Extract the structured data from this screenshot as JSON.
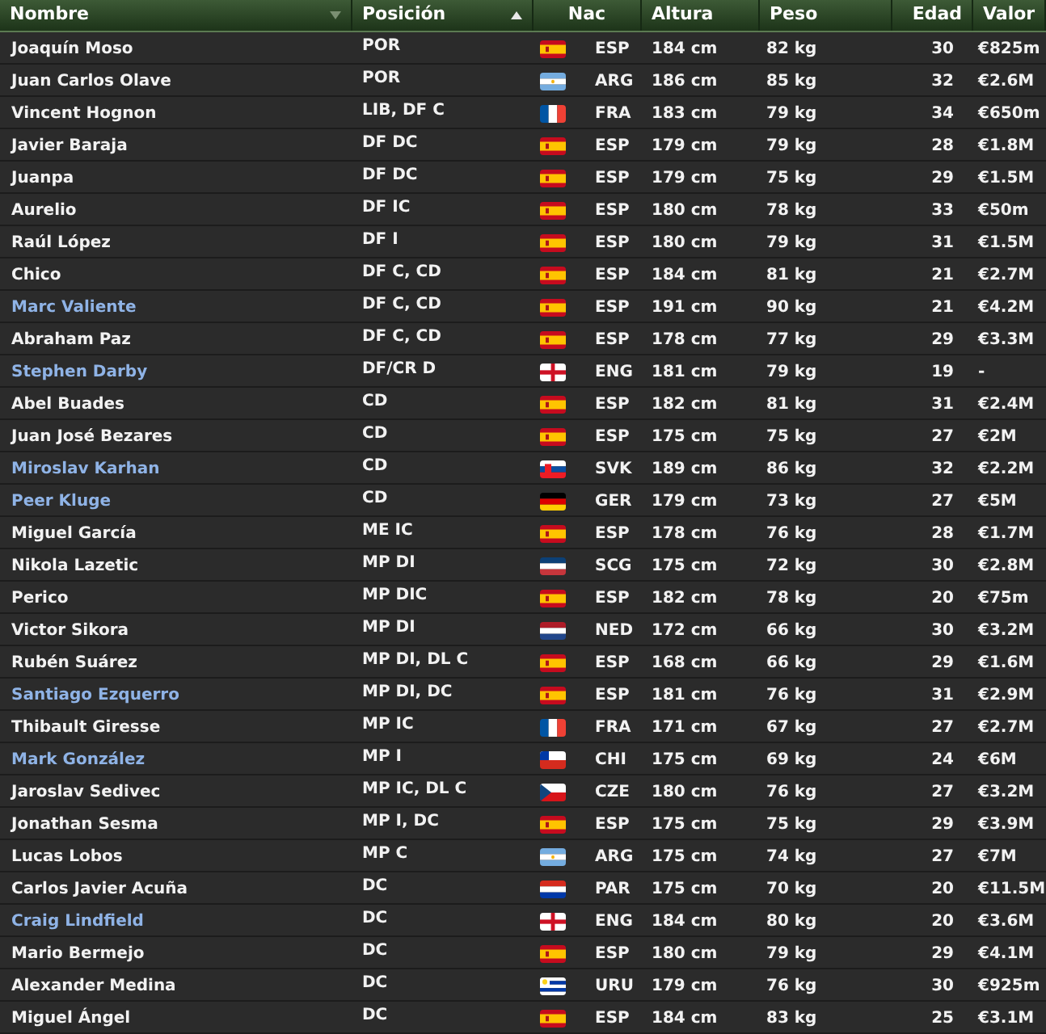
{
  "columns": [
    {
      "label": "Nombre",
      "sort": {
        "kind": "desc"
      }
    },
    {
      "label": "Posición",
      "sort": {
        "kind": "asc"
      }
    },
    {
      "label": "Nac"
    },
    {
      "label": "Altura"
    },
    {
      "label": "Peso"
    },
    {
      "label": "Edad"
    },
    {
      "label": "Valor"
    }
  ],
  "rows": [
    {
      "name": "Joaquín Moso",
      "highlighted": false,
      "position": "POR",
      "flag": {
        "kind": "es"
      },
      "nation": "ESP",
      "height": "184 cm",
      "weight": "82 kg",
      "age": "30",
      "value": "€825m"
    },
    {
      "name": "Juan Carlos Olave",
      "highlighted": false,
      "position": "POR",
      "flag": {
        "kind": "ar"
      },
      "nation": "ARG",
      "height": "186 cm",
      "weight": "85 kg",
      "age": "32",
      "value": "€2.6M"
    },
    {
      "name": "Vincent Hognon",
      "highlighted": false,
      "position": "LIB, DF C",
      "flag": {
        "kind": "fr"
      },
      "nation": "FRA",
      "height": "183 cm",
      "weight": "79 kg",
      "age": "34",
      "value": "€650m"
    },
    {
      "name": "Javier Baraja",
      "highlighted": false,
      "position": "DF DC",
      "flag": {
        "kind": "es"
      },
      "nation": "ESP",
      "height": "179 cm",
      "weight": "79 kg",
      "age": "28",
      "value": "€1.8M"
    },
    {
      "name": "Juanpa",
      "highlighted": false,
      "position": "DF DC",
      "flag": {
        "kind": "es"
      },
      "nation": "ESP",
      "height": "179 cm",
      "weight": "75 kg",
      "age": "29",
      "value": "€1.5M"
    },
    {
      "name": "Aurelio",
      "highlighted": false,
      "position": "DF IC",
      "flag": {
        "kind": "es"
      },
      "nation": "ESP",
      "height": "180 cm",
      "weight": "78 kg",
      "age": "33",
      "value": "€50m"
    },
    {
      "name": "Raúl López",
      "highlighted": false,
      "position": "DF I",
      "flag": {
        "kind": "es"
      },
      "nation": "ESP",
      "height": "180 cm",
      "weight": "79 kg",
      "age": "31",
      "value": "€1.5M"
    },
    {
      "name": "Chico",
      "highlighted": false,
      "position": "DF C, CD",
      "flag": {
        "kind": "es"
      },
      "nation": "ESP",
      "height": "184 cm",
      "weight": "81 kg",
      "age": "21",
      "value": "€2.7M"
    },
    {
      "name": "Marc Valiente",
      "highlighted": true,
      "position": "DF C, CD",
      "flag": {
        "kind": "es"
      },
      "nation": "ESP",
      "height": "191 cm",
      "weight": "90 kg",
      "age": "21",
      "value": "€4.2M"
    },
    {
      "name": "Abraham Paz",
      "highlighted": false,
      "position": "DF C, CD",
      "flag": {
        "kind": "es"
      },
      "nation": "ESP",
      "height": "178 cm",
      "weight": "77 kg",
      "age": "29",
      "value": "€3.3M"
    },
    {
      "name": "Stephen Darby",
      "highlighted": true,
      "position": "DF/CR D",
      "flag": {
        "kind": "en"
      },
      "nation": "ENG",
      "height": "181 cm",
      "weight": "79 kg",
      "age": "19",
      "value": "-"
    },
    {
      "name": "Abel Buades",
      "highlighted": false,
      "position": "CD",
      "flag": {
        "kind": "es"
      },
      "nation": "ESP",
      "height": "182 cm",
      "weight": "81 kg",
      "age": "31",
      "value": "€2.4M"
    },
    {
      "name": "Juan José Bezares",
      "highlighted": false,
      "position": "CD",
      "flag": {
        "kind": "es"
      },
      "nation": "ESP",
      "height": "175 cm",
      "weight": "75 kg",
      "age": "27",
      "value": "€2M"
    },
    {
      "name": "Miroslav Karhan",
      "highlighted": true,
      "position": "CD",
      "flag": {
        "kind": "sk"
      },
      "nation": "SVK",
      "height": "189 cm",
      "weight": "86 kg",
      "age": "32",
      "value": "€2.2M"
    },
    {
      "name": "Peer Kluge",
      "highlighted": true,
      "position": "CD",
      "flag": {
        "kind": "de"
      },
      "nation": "GER",
      "height": "179 cm",
      "weight": "73 kg",
      "age": "27",
      "value": "€5M"
    },
    {
      "name": "Miguel García",
      "highlighted": false,
      "position": "ME IC",
      "flag": {
        "kind": "es"
      },
      "nation": "ESP",
      "height": "178 cm",
      "weight": "76 kg",
      "age": "28",
      "value": "€1.7M"
    },
    {
      "name": "Nikola Lazetic",
      "highlighted": false,
      "position": "MP DI",
      "flag": {
        "kind": "rs"
      },
      "nation": "SCG",
      "height": "175 cm",
      "weight": "72 kg",
      "age": "30",
      "value": "€2.8M"
    },
    {
      "name": "Perico",
      "highlighted": false,
      "position": "MP DIC",
      "flag": {
        "kind": "es"
      },
      "nation": "ESP",
      "height": "182 cm",
      "weight": "78 kg",
      "age": "20",
      "value": "€75m"
    },
    {
      "name": "Victor Sikora",
      "highlighted": false,
      "position": "MP DI",
      "flag": {
        "kind": "nl"
      },
      "nation": "NED",
      "height": "172 cm",
      "weight": "66 kg",
      "age": "30",
      "value": "€3.2M"
    },
    {
      "name": "Rubén Suárez",
      "highlighted": false,
      "position": "MP DI, DL C",
      "flag": {
        "kind": "es"
      },
      "nation": "ESP",
      "height": "168 cm",
      "weight": "66 kg",
      "age": "29",
      "value": "€1.6M"
    },
    {
      "name": "Santiago Ezquerro",
      "highlighted": true,
      "position": "MP DI, DC",
      "flag": {
        "kind": "es"
      },
      "nation": "ESP",
      "height": "181 cm",
      "weight": "76 kg",
      "age": "31",
      "value": "€2.9M"
    },
    {
      "name": "Thibault Giresse",
      "highlighted": false,
      "position": "MP IC",
      "flag": {
        "kind": "fr"
      },
      "nation": "FRA",
      "height": "171 cm",
      "weight": "67 kg",
      "age": "27",
      "value": "€2.7M"
    },
    {
      "name": "Mark González",
      "highlighted": true,
      "position": "MP I",
      "flag": {
        "kind": "cl"
      },
      "nation": "CHI",
      "height": "175 cm",
      "weight": "69 kg",
      "age": "24",
      "value": "€6M"
    },
    {
      "name": "Jaroslav Sedivec",
      "highlighted": false,
      "position": "MP IC, DL C",
      "flag": {
        "kind": "cz"
      },
      "nation": "CZE",
      "height": "180 cm",
      "weight": "76 kg",
      "age": "27",
      "value": "€3.2M"
    },
    {
      "name": "Jonathan Sesma",
      "highlighted": false,
      "position": "MP I, DC",
      "flag": {
        "kind": "es"
      },
      "nation": "ESP",
      "height": "175 cm",
      "weight": "75 kg",
      "age": "29",
      "value": "€3.9M"
    },
    {
      "name": "Lucas Lobos",
      "highlighted": false,
      "position": "MP C",
      "flag": {
        "kind": "ar"
      },
      "nation": "ARG",
      "height": "175 cm",
      "weight": "74 kg",
      "age": "27",
      "value": "€7M"
    },
    {
      "name": "Carlos Javier Acuña",
      "highlighted": false,
      "position": "DC",
      "flag": {
        "kind": "py"
      },
      "nation": "PAR",
      "height": "175 cm",
      "weight": "70 kg",
      "age": "20",
      "value": "€11.5M"
    },
    {
      "name": "Craig Lindfield",
      "highlighted": true,
      "position": "DC",
      "flag": {
        "kind": "en"
      },
      "nation": "ENG",
      "height": "184 cm",
      "weight": "80 kg",
      "age": "20",
      "value": "€3.6M"
    },
    {
      "name": "Mario Bermejo",
      "highlighted": false,
      "position": "DC",
      "flag": {
        "kind": "es"
      },
      "nation": "ESP",
      "height": "180 cm",
      "weight": "79 kg",
      "age": "29",
      "value": "€4.1M"
    },
    {
      "name": "Alexander Medina",
      "highlighted": false,
      "position": "DC",
      "flag": {
        "kind": "uy"
      },
      "nation": "URU",
      "height": "179 cm",
      "weight": "76 kg",
      "age": "30",
      "value": "€925m"
    },
    {
      "name": "Miguel Ángel",
      "highlighted": false,
      "position": "DC",
      "flag": {
        "kind": "es"
      },
      "nation": "ESP",
      "height": "184 cm",
      "weight": "83 kg",
      "age": "25",
      "value": "€3.1M"
    }
  ]
}
